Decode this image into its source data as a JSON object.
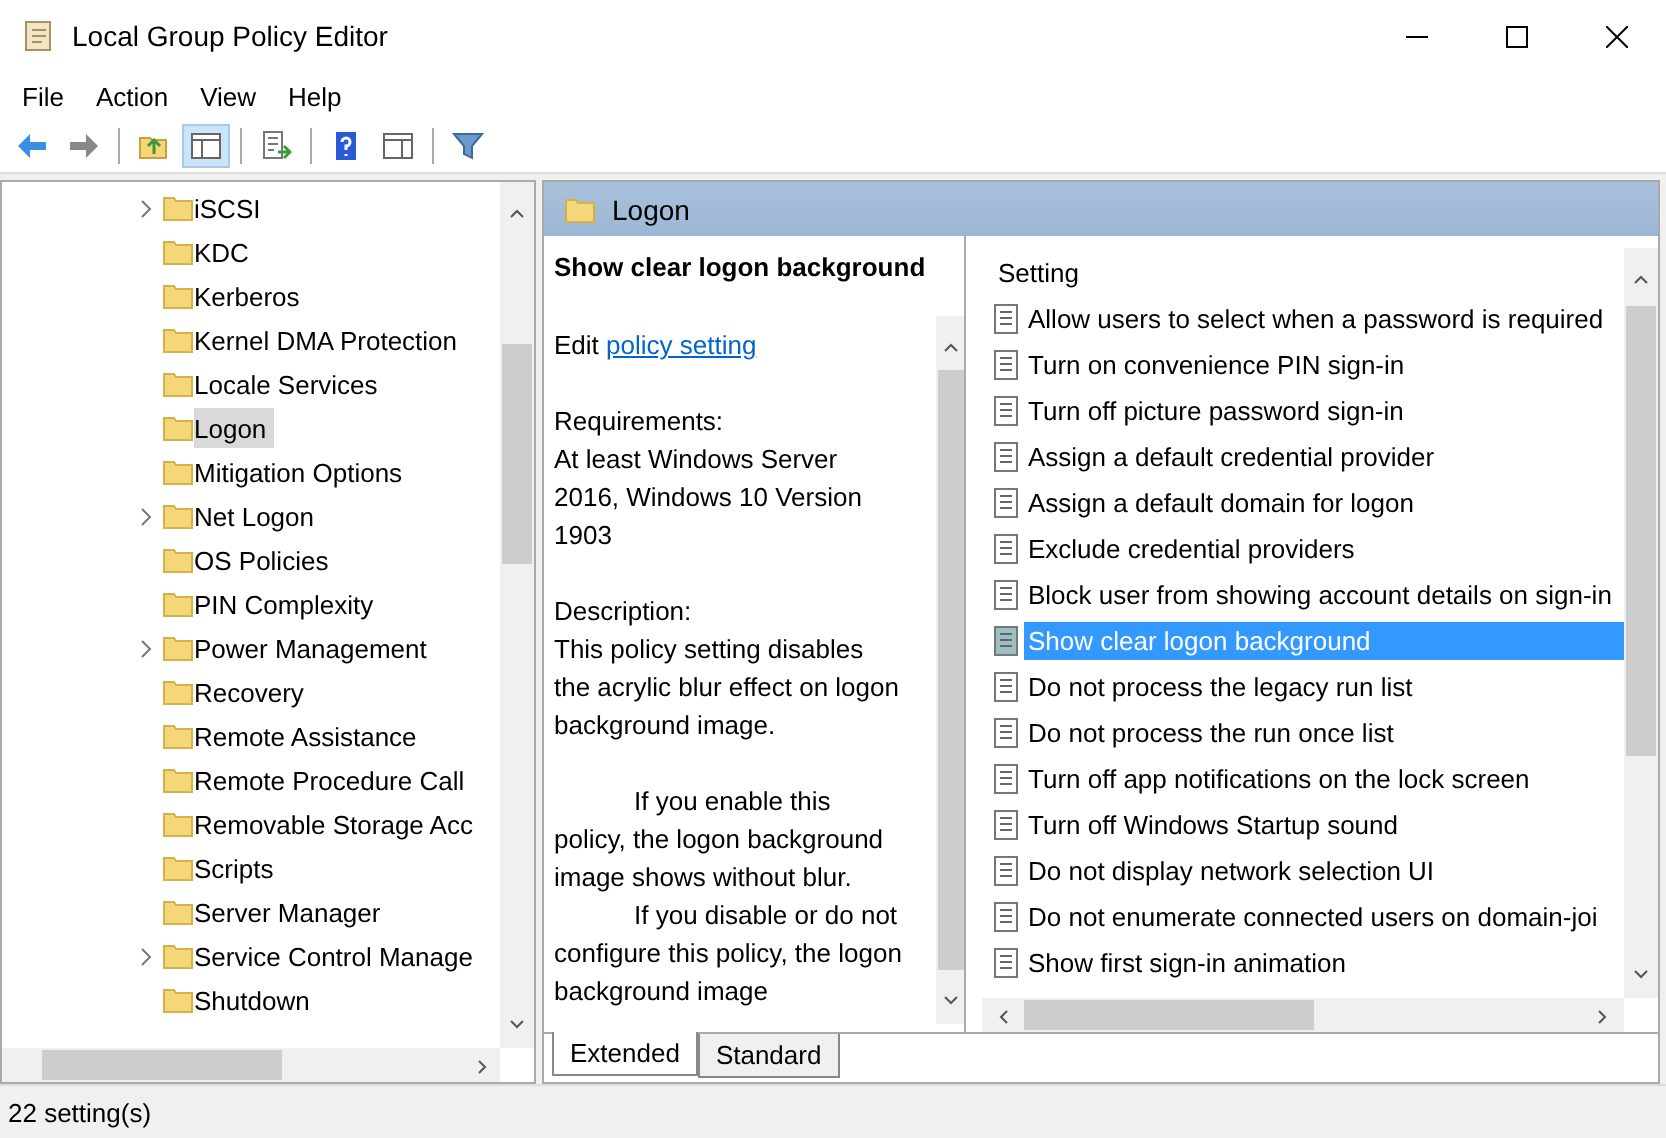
{
  "window": {
    "title": "Local Group Policy Editor"
  },
  "menu": [
    "File",
    "Action",
    "View",
    "Help"
  ],
  "toolbar": [
    {
      "kind": "back",
      "pressed": false
    },
    {
      "kind": "forward",
      "pressed": false
    },
    {
      "kind": "sep"
    },
    {
      "kind": "up",
      "pressed": false
    },
    {
      "kind": "tree",
      "pressed": true
    },
    {
      "kind": "sep"
    },
    {
      "kind": "export",
      "pressed": false
    },
    {
      "kind": "sep"
    },
    {
      "kind": "help",
      "pressed": false
    },
    {
      "kind": "pane",
      "pressed": false
    },
    {
      "kind": "sep"
    },
    {
      "kind": "filter",
      "pressed": false
    }
  ],
  "tree": [
    {
      "label": "iSCSI",
      "expandable": true,
      "selected": false
    },
    {
      "label": "KDC",
      "expandable": false,
      "selected": false
    },
    {
      "label": "Kerberos",
      "expandable": false,
      "selected": false
    },
    {
      "label": "Kernel DMA Protection",
      "expandable": false,
      "selected": false
    },
    {
      "label": "Locale Services",
      "expandable": false,
      "selected": false
    },
    {
      "label": "Logon",
      "expandable": false,
      "selected": true
    },
    {
      "label": "Mitigation Options",
      "expandable": false,
      "selected": false
    },
    {
      "label": "Net Logon",
      "expandable": true,
      "selected": false
    },
    {
      "label": "OS Policies",
      "expandable": false,
      "selected": false
    },
    {
      "label": "PIN Complexity",
      "expandable": false,
      "selected": false
    },
    {
      "label": "Power Management",
      "expandable": true,
      "selected": false
    },
    {
      "label": "Recovery",
      "expandable": false,
      "selected": false
    },
    {
      "label": "Remote Assistance",
      "expandable": false,
      "selected": false
    },
    {
      "label": "Remote Procedure Call",
      "expandable": false,
      "selected": false
    },
    {
      "label": "Removable Storage Acc",
      "expandable": false,
      "selected": false
    },
    {
      "label": "Scripts",
      "expandable": false,
      "selected": false
    },
    {
      "label": "Server Manager",
      "expandable": false,
      "selected": false
    },
    {
      "label": "Service Control Manage",
      "expandable": true,
      "selected": false
    },
    {
      "label": "Shutdown",
      "expandable": false,
      "selected": false
    }
  ],
  "header": {
    "title": "Logon"
  },
  "description": {
    "heading": "Show clear logon background",
    "edit_prefix": "Edit",
    "edit_link": "policy setting",
    "requirements_label": "Requirements:",
    "requirements": "At least Windows Server 2016, Windows 10 Version 1903",
    "description_label": "Description:",
    "paragraphs": [
      "This policy setting disables the acrylic blur effect on logon background image.",
      "If you enable this policy, the logon background image shows without blur.",
      "If you disable or do not configure this policy, the logon background image"
    ]
  },
  "list": {
    "column": "Setting",
    "rows": [
      {
        "label": "Allow users to select when a password is required",
        "selected": false
      },
      {
        "label": "Turn on convenience PIN sign-in",
        "selected": false
      },
      {
        "label": "Turn off picture password sign-in",
        "selected": false
      },
      {
        "label": "Assign a default credential provider",
        "selected": false
      },
      {
        "label": "Assign a default domain for logon",
        "selected": false
      },
      {
        "label": "Exclude credential providers",
        "selected": false
      },
      {
        "label": "Block user from showing account details on sign-in",
        "selected": false
      },
      {
        "label": "Show clear logon background",
        "selected": true
      },
      {
        "label": "Do not process the legacy run list",
        "selected": false
      },
      {
        "label": "Do not process the run once list",
        "selected": false
      },
      {
        "label": "Turn off app notifications on the lock screen",
        "selected": false
      },
      {
        "label": "Turn off Windows Startup sound",
        "selected": false
      },
      {
        "label": "Do not display network selection UI",
        "selected": false
      },
      {
        "label": "Do not enumerate connected users on domain-joi",
        "selected": false
      },
      {
        "label": "Show first sign-in animation",
        "selected": false
      }
    ]
  },
  "tabs": [
    {
      "label": "Extended",
      "selected": true
    },
    {
      "label": "Standard",
      "selected": false
    }
  ],
  "status_bar": "22 setting(s)"
}
